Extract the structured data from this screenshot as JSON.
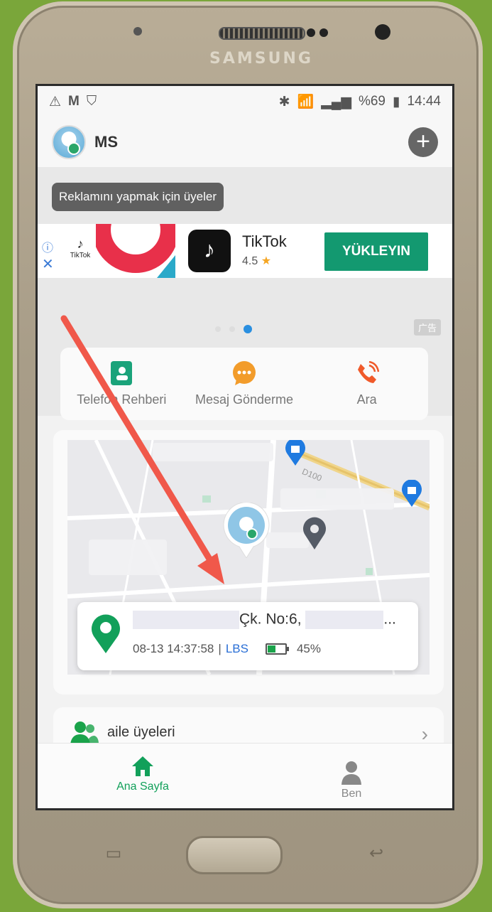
{
  "device": {
    "brand": "SAMSUNG"
  },
  "status_bar": {
    "battery": "%69",
    "time": "14:44"
  },
  "header": {
    "title": "MS"
  },
  "ad": {
    "tooltip": "Reklamını yapmak için üyeler",
    "small_brand": "TikTok",
    "app_name": "TikTok",
    "rating": "4.5",
    "install_label": "YÜKLEYIN",
    "tag": "广告",
    "info_icon": "info-icon",
    "close_icon": "close-icon"
  },
  "actions": [
    {
      "label": "Telefon Rehberi",
      "icon": "contacts-icon",
      "color": "#1aa37a"
    },
    {
      "label": "Mesaj Gönderme",
      "icon": "message-icon",
      "color": "#f29c2b"
    },
    {
      "label": "Ara",
      "icon": "phone-icon",
      "color": "#f05a2a"
    }
  ],
  "map": {
    "road_label": "D100"
  },
  "location_card": {
    "address_visible": "Çk. No:6,",
    "address_suffix": "...",
    "timestamp": "08-13 14:37:58",
    "separator": "|",
    "source": "LBS",
    "battery_percent": "45%",
    "battery_level": 0.45
  },
  "family": {
    "label": "aile üyeleri"
  },
  "bottom_nav": [
    {
      "label": "Ana Sayfa",
      "icon": "home-icon",
      "active": true
    },
    {
      "label": "Ben",
      "icon": "person-icon",
      "active": false
    }
  ],
  "colors": {
    "accent": "#12a05a",
    "install_button": "#139970",
    "annotation_arrow": "#f0584a"
  }
}
